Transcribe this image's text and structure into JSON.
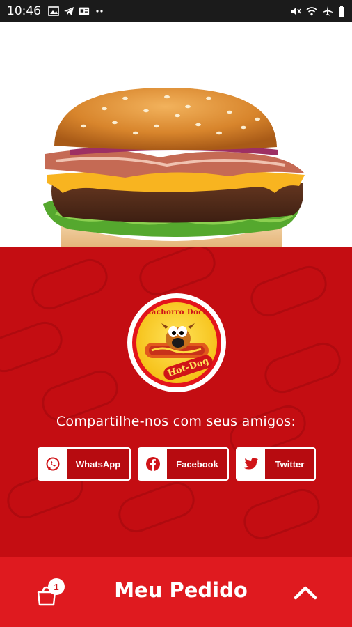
{
  "status_bar": {
    "time": "10:46",
    "left_icons": [
      "image-icon",
      "telegram-icon",
      "news-icon",
      "more-dots-icon"
    ],
    "right_icons": [
      "mute-icon",
      "wifi-icon",
      "airplane-icon",
      "battery-icon"
    ]
  },
  "hero": {
    "image": "burger-photo"
  },
  "logo": {
    "top_text": "Cachorro Doce",
    "bottom_text": "Hot-Dog"
  },
  "share": {
    "title": "Compartilhe-nos com seus amigos:",
    "whatsapp_label": "WhatsApp",
    "facebook_label": "Facebook",
    "twitter_label": "Twitter"
  },
  "bottom_bar": {
    "cart_count": "1",
    "title": "Meu Pedido"
  },
  "colors": {
    "red_background": "#c40d12",
    "bottom_bar": "#df1a1f",
    "status_bar": "#1b1b1b"
  }
}
